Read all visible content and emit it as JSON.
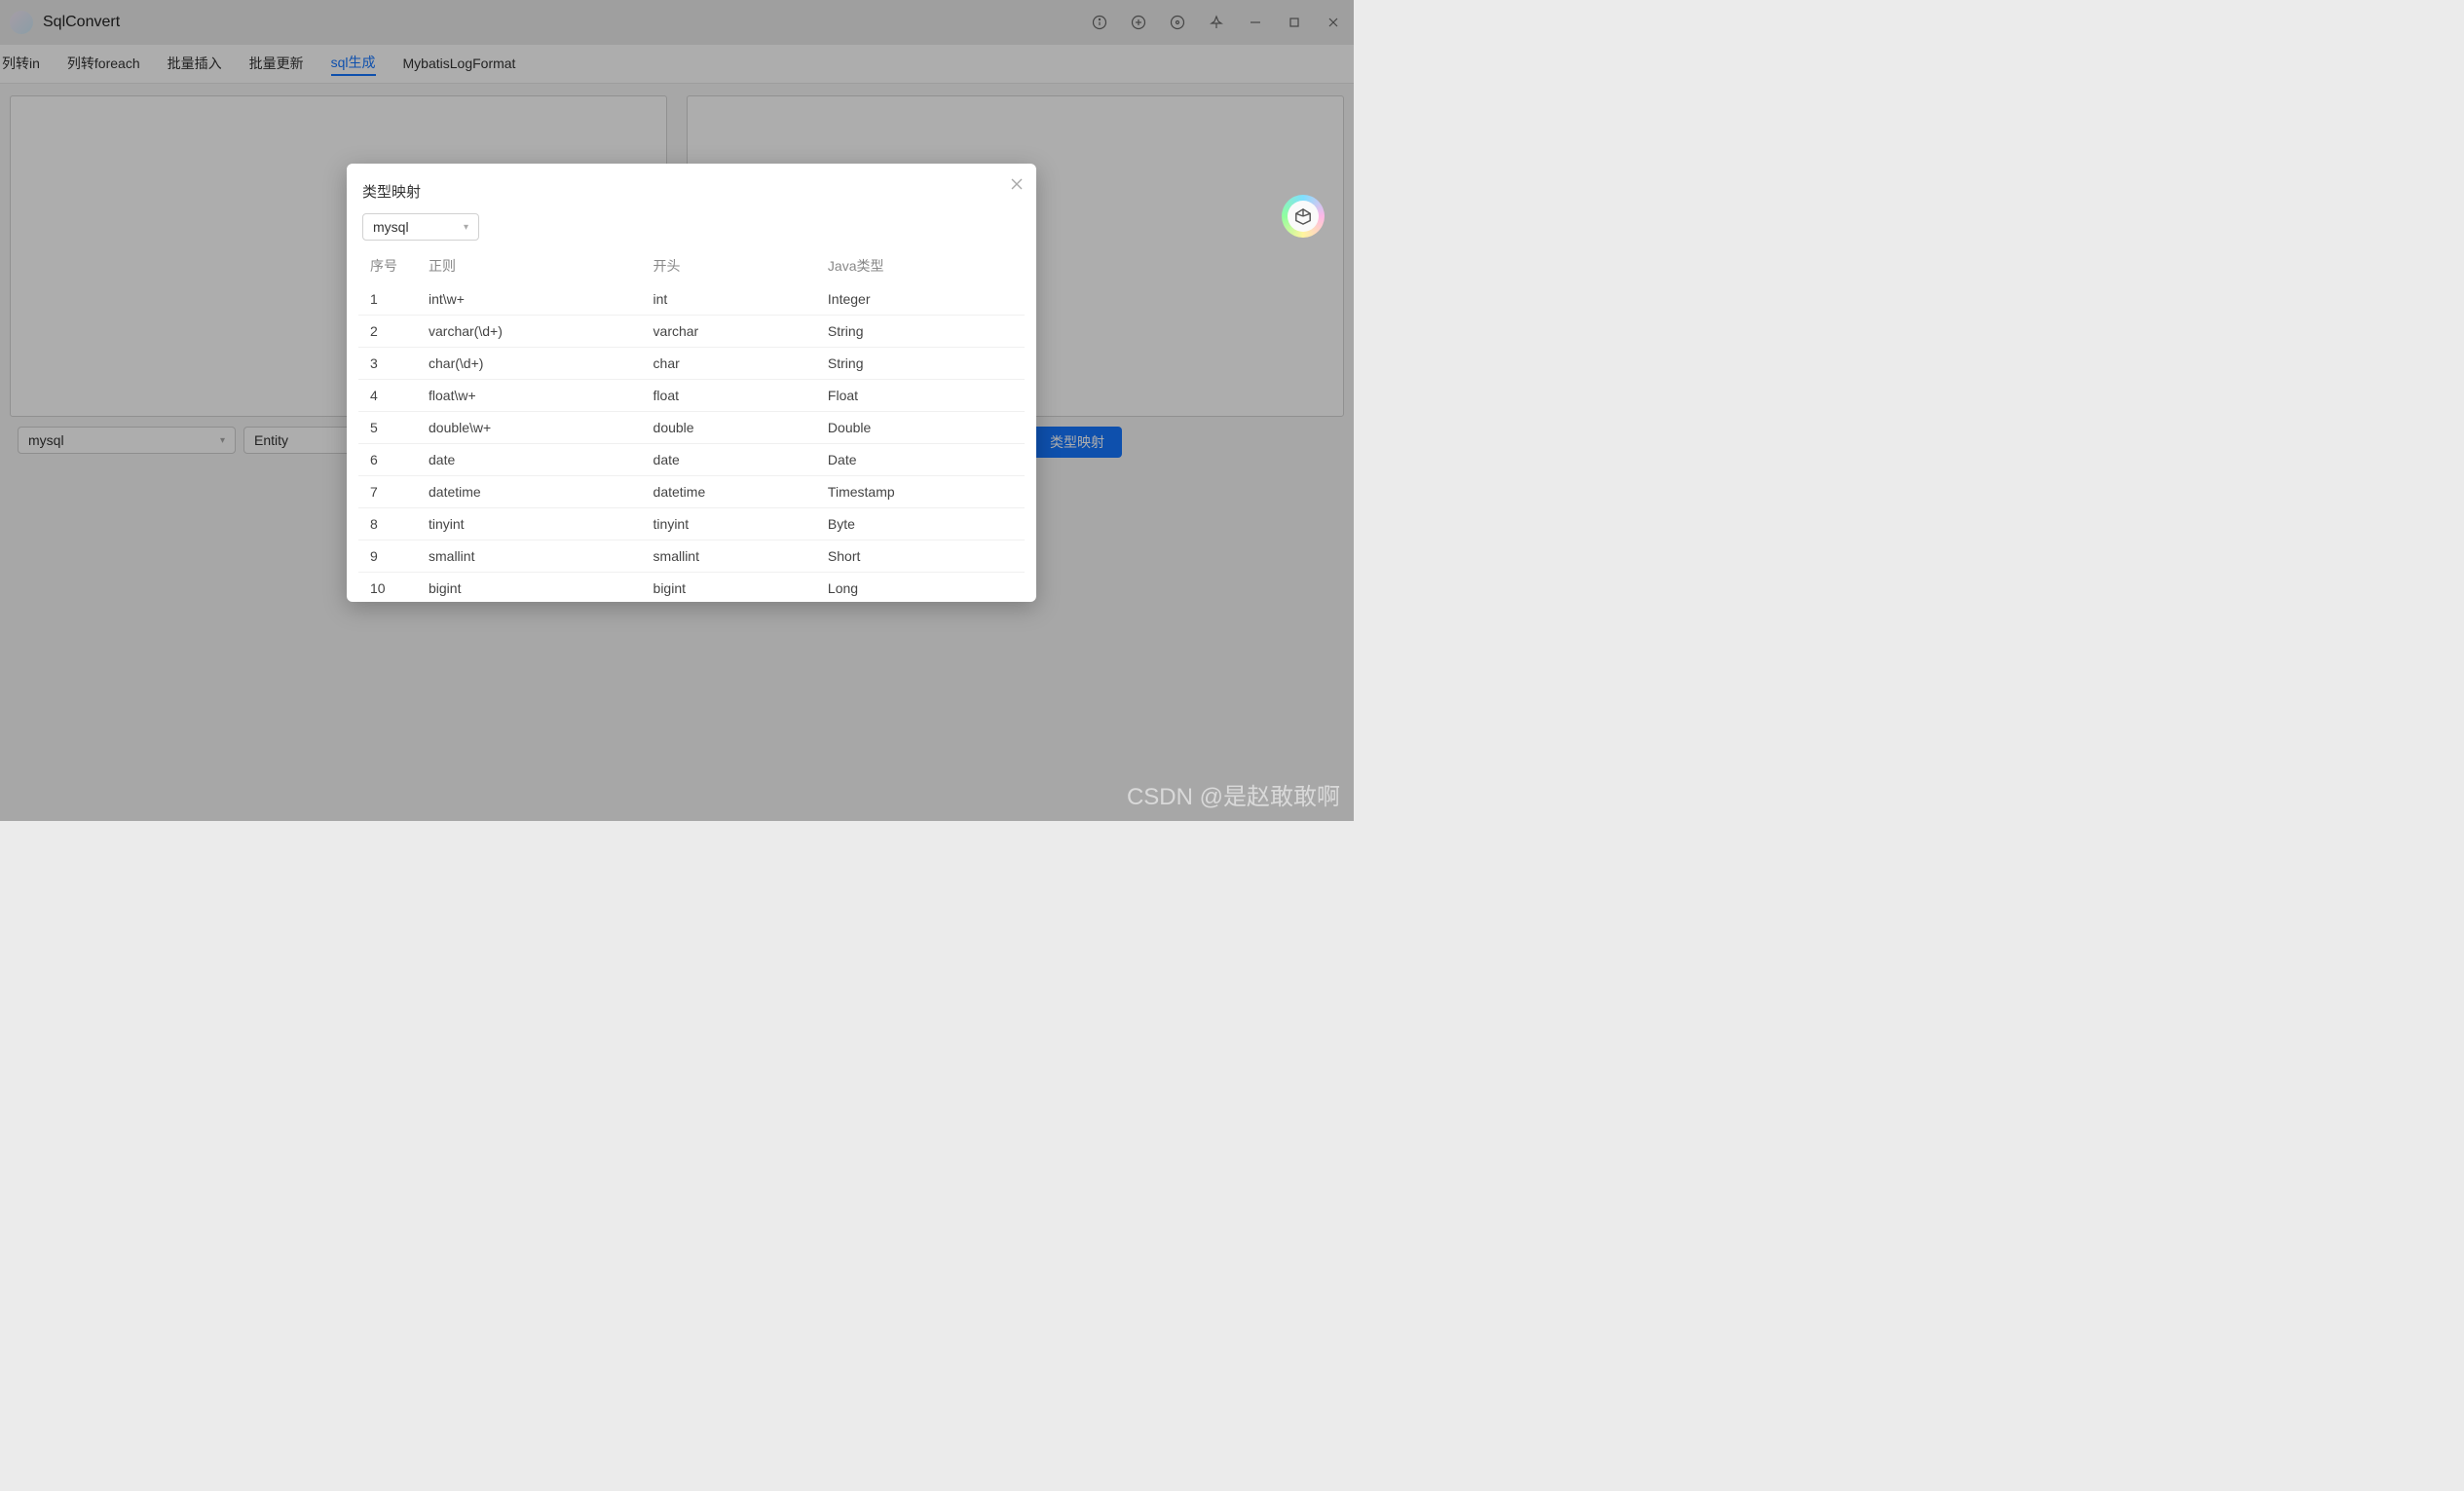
{
  "titlebar": {
    "title": "SqlConvert"
  },
  "tabs": [
    "列转in",
    "列转foreach",
    "批量插入",
    "批量更新",
    "sql生成",
    "MybatisLogFormat"
  ],
  "activeTabIndex": 4,
  "bottomBar": {
    "select1": "mysql",
    "select2": "Entity",
    "primaryBtn": "类型映射"
  },
  "modal": {
    "title": "类型映射",
    "select": "mysql",
    "columns": [
      "序号",
      "正则",
      "开头",
      "Java类型"
    ],
    "rows": [
      {
        "seq": "1",
        "regex": "int\\w+",
        "prefix": "int",
        "javaType": "Integer"
      },
      {
        "seq": "2",
        "regex": "varchar(\\d+)",
        "prefix": "varchar",
        "javaType": "String"
      },
      {
        "seq": "3",
        "regex": "char(\\d+)",
        "prefix": "char",
        "javaType": "String"
      },
      {
        "seq": "4",
        "regex": "float\\w+",
        "prefix": "float",
        "javaType": "Float"
      },
      {
        "seq": "5",
        "regex": "double\\w+",
        "prefix": "double",
        "javaType": "Double"
      },
      {
        "seq": "6",
        "regex": "date",
        "prefix": "date",
        "javaType": "Date"
      },
      {
        "seq": "7",
        "regex": "datetime",
        "prefix": "datetime",
        "javaType": "Timestamp"
      },
      {
        "seq": "8",
        "regex": "tinyint",
        "prefix": "tinyint",
        "javaType": "Byte"
      },
      {
        "seq": "9",
        "regex": "smallint",
        "prefix": "smallint",
        "javaType": "Short"
      },
      {
        "seq": "10",
        "regex": "bigint",
        "prefix": "bigint",
        "javaType": "Long"
      }
    ]
  },
  "watermark": "CSDN @是赵敢敢啊"
}
